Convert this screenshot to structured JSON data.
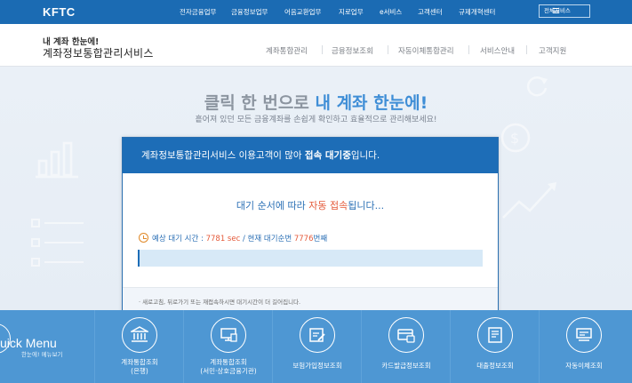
{
  "topbar": {
    "logo": "KFTC",
    "nav": [
      "전자금융업무",
      "금융정보업무",
      "어음교환업무",
      "지로업무",
      "e서비스",
      "고객센터",
      "규제개혁센터"
    ],
    "all_services": "전체서비스"
  },
  "header": {
    "brand_sub": "내 계좌 한눈에!",
    "brand_main": "계좌정보통합관리서비스",
    "nav": [
      "계좌통합관리",
      "금융정보조회",
      "자동이체통합관리",
      "서비스안내",
      "고객지원"
    ]
  },
  "hero": {
    "title_prefix": "클릭 한 번으로 ",
    "title_highlight": "내 계좌 한눈에!",
    "subtitle": "흩어져 있던 모든 금융계좌를 손쉽게 확인하고 효율적으로 관리해보세요!"
  },
  "modal": {
    "head_prefix": "계좌정보통합관리서비스 이용고객이 많아 ",
    "head_bold": "접속 대기중",
    "head_suffix": "입니다.",
    "order_prefix": "대기 순서에 따라 ",
    "order_red": "자동 접속",
    "order_suffix": "됩니다...",
    "wait_label": "예상 대기 시간 : ",
    "wait_time": "7781 sec",
    "queue_label": " / 현재 대기순번 ",
    "queue_number": "7776",
    "queue_suffix": "번째",
    "progress_fraction": 0.0,
    "foot_note": "· 새로고침, 뒤로가기 또는 재접속하시면 대기시간이 더 길어집니다."
  },
  "quick_menu": {
    "title": "uick Menu",
    "subtitle": "한눈에! 메뉴보기",
    "items": [
      {
        "line1": "계좌통합조회",
        "line2": "(은행)",
        "icon": "bank-icon"
      },
      {
        "line1": "계좌통합조회",
        "line2": "(서민·상호금융기관)",
        "icon": "computer-icon"
      },
      {
        "line1": "보험가입정보조회",
        "line2": "",
        "icon": "insurance-icon"
      },
      {
        "line1": "카드발급정보조회",
        "line2": "",
        "icon": "card-icon"
      },
      {
        "line1": "대출정보조회",
        "line2": "",
        "icon": "loan-document-icon"
      },
      {
        "line1": "자동이체조회",
        "line2": "",
        "icon": "auto-transfer-icon"
      }
    ]
  },
  "colors": {
    "primary": "#1d6db7",
    "quick_menu_bg": "#4e97d3",
    "highlight": "#3f8ed6",
    "alert": "#e45a3a"
  }
}
